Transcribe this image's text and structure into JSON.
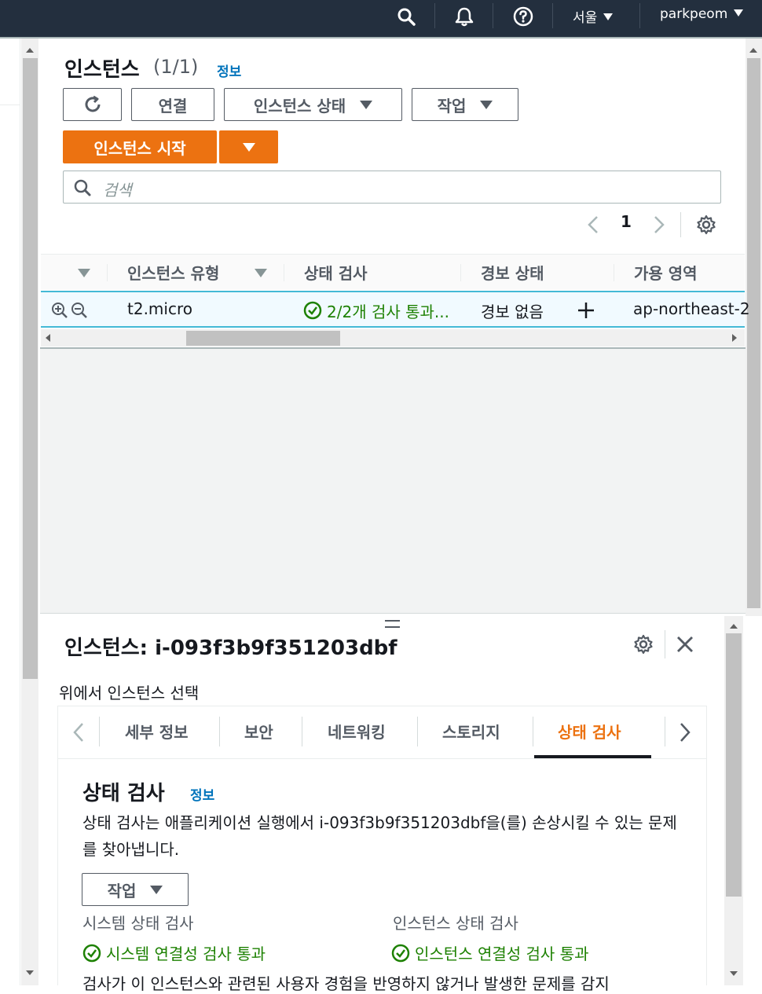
{
  "topbar": {
    "search_icon": "search-icon",
    "bell_icon": "bell-icon",
    "help_icon": "help-icon",
    "region": "서울",
    "user": "parkpeom"
  },
  "instances": {
    "title": "인스턴스",
    "count": "(1/1)",
    "info_link": "정보",
    "refresh_icon": "refresh-icon",
    "connect_label": "연결",
    "state_label": "인스턴스 상태",
    "actions_label": "작업",
    "launch_label": "인스턴스 시작",
    "search_placeholder": "검색",
    "page_number": "1"
  },
  "table": {
    "columns": [
      "인스턴스 유형",
      "상태 검사",
      "경보 상태",
      "가용 영역"
    ],
    "rows": [
      {
        "type": "t2.micro",
        "status_check": "2/2개 검사 통과...",
        "alarm": "경보 없음",
        "az": "ap-northeast-2"
      }
    ]
  },
  "detail": {
    "title": "인스턴스: i-093f3b9f351203dbf",
    "subtitle": "위에서 인스턴스 선택",
    "tabs": [
      "세부 정보",
      "보안",
      "네트워킹",
      "스토리지",
      "상태 검사"
    ],
    "active_tab": "상태 검사",
    "section_title": "상태 검사",
    "section_info": "정보",
    "description": "상태 검사는 애플리케이션 실행에서 i-093f3b9f351203dbf을(를) 손상시킬 수 있는 문제를 찾아냅니다.",
    "actions_label": "작업",
    "system_check_label": "시스템 상태 검사",
    "system_check_value": "시스템 연결성 검사 통과",
    "instance_check_label": "인스턴스 상태 검사",
    "instance_check_value": "인스턴스 연결성 검사 통과",
    "cutoff_text": "검사가 이 인스턴스와 관련된 사용자 경험을 반영하지 않거나 발생한 문제를 감지"
  },
  "colors": {
    "header_bg": "#232f3e",
    "primary_orange": "#ec7211",
    "link_blue": "#0073bb",
    "success_green": "#1d8102",
    "active_tab_orange": "#ec7211"
  }
}
